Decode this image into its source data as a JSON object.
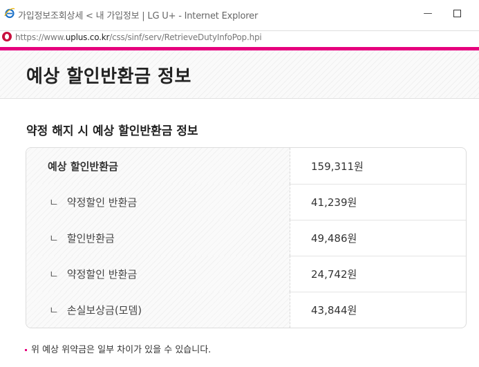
{
  "window": {
    "title": "가입정보조회상세 < 내 가입정보 | LG U+ - Internet Explorer",
    "minimize_label": "—",
    "url_prefix": "https://www.",
    "url_domain": "uplus.co.kr",
    "url_path": "/css/sinf/serv/RetrieveDutyInfoPop.hpi"
  },
  "page": {
    "title": "예상 할인반환금 정보",
    "section_title": "약정 해지 시 예상 할인반환금 정보"
  },
  "table": {
    "sub_marker": "ㄴ",
    "rows": [
      {
        "label": "예상 할인반환금",
        "value": "159,311원"
      },
      {
        "label": "약정할인 반환금",
        "value": "41,239원"
      },
      {
        "label": "할인반환금",
        "value": "49,486원"
      },
      {
        "label": "약정할인 반환금",
        "value": "24,742원"
      },
      {
        "label": "손실보상금(모뎀)",
        "value": "43,844원"
      }
    ]
  },
  "note": "위 예상 위약금은 일부 차이가 있을 수 있습니다.",
  "colors": {
    "accent": "#e6007e",
    "ie_blue": "#1e73c9"
  }
}
